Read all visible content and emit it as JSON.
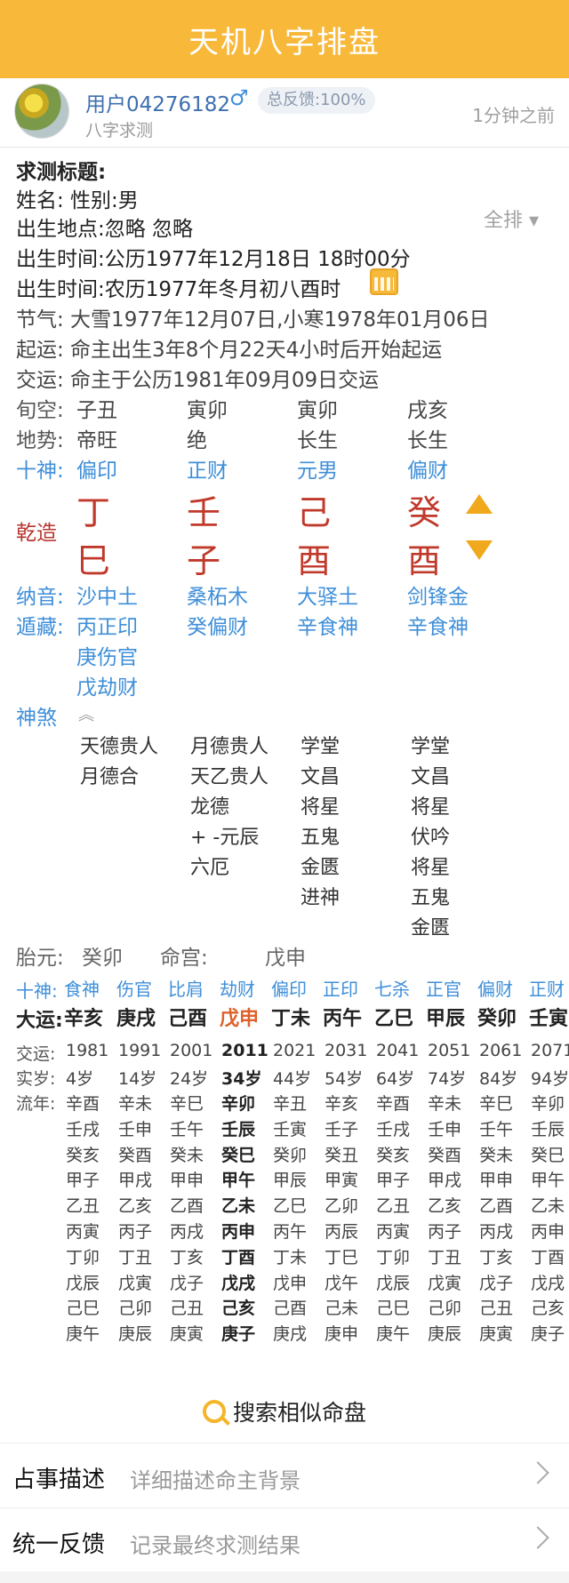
{
  "header": {
    "title": "天机八字排盘"
  },
  "user": {
    "name": "用户04276182",
    "gender_symbol": "♂",
    "feedback": "总反馈:100%",
    "subtitle": "八字求测",
    "time": "1分钟之前"
  },
  "info": {
    "title_label": "求测标题:",
    "name_line": "姓名:  性别:男",
    "place_line": "出生地点:忽略  忽略",
    "solar_line": "出生时间:公历1977年12月18日 18时00分",
    "lunar_line": "出生时间:农历1977年冬月初八酉时",
    "jieqi_line": "节气: 大雪1977年12月07日,小寒1978年01月06日",
    "qiyun_line": "起运: 命主出生3年8个月22天4小时后开始起运",
    "jiaoyun_line": "交运: 命主于公历1981年09月09日交运",
    "full_button": "全排 ▾"
  },
  "pillars": {
    "labels": {
      "xunkong": "旬空:",
      "dishi": "地势:",
      "shishen": "十神:",
      "qianzao": "乾造",
      "nayin": "纳音:",
      "dunchang": "遁藏:",
      "shensha": "神煞"
    },
    "xunkong": [
      "子丑",
      "寅卯",
      "寅卯",
      "戌亥"
    ],
    "dishi": [
      "帝旺",
      "绝",
      "长生",
      "长生"
    ],
    "shishen": [
      "偏印",
      "正财",
      "元男",
      "偏财"
    ],
    "stems": [
      "丁",
      "壬",
      "己",
      "癸"
    ],
    "branches": [
      "巳",
      "子",
      "酉",
      "酉"
    ],
    "nayin": [
      "沙中土",
      "桑柘木",
      "大驿土",
      "剑锋金"
    ],
    "canggan": [
      [
        "丙正印",
        "庚伤官",
        "戊劫财"
      ],
      [
        "癸偏财"
      ],
      [
        "辛食神"
      ],
      [
        "辛食神"
      ]
    ],
    "shensha": [
      [
        "天德贵人",
        "月德合"
      ],
      [
        "月德贵人",
        "天乙贵人",
        "龙德",
        "+ -元辰",
        "六厄"
      ],
      [
        "学堂",
        "文昌",
        "将星",
        "五鬼",
        "金匮",
        "进神"
      ],
      [
        "学堂",
        "文昌",
        "将星",
        "伏吟",
        "将星",
        "五鬼",
        "金匮"
      ]
    ]
  },
  "taiyuan": {
    "label1": "胎元:",
    "value1": "癸卯",
    "label2": "命宫:",
    "value2": "戊申"
  },
  "dayun": {
    "shishen_label": "十神:",
    "dayun_label": "大运:",
    "jiaoyun_label": "交运:",
    "shisui_label": "实岁:",
    "liunian_label": "流年:",
    "shishen": [
      "食神",
      "伤官",
      "比肩",
      "劫财",
      "偏印",
      "正印",
      "七杀",
      "正官",
      "偏财",
      "正财"
    ],
    "dayun": [
      "辛亥",
      "庚戌",
      "己酉",
      "戊申",
      "丁未",
      "丙午",
      "乙巳",
      "甲辰",
      "癸卯",
      "壬寅"
    ],
    "years": [
      "1981",
      "1991",
      "2001",
      "2011",
      "2021",
      "2031",
      "2041",
      "2051",
      "2061",
      "2071"
    ],
    "ages": [
      "4岁",
      "14岁",
      "24岁",
      "34岁",
      "44岁",
      "54岁",
      "64岁",
      "74岁",
      "84岁",
      "94岁"
    ],
    "selected_index": 3,
    "liunian": [
      [
        "辛酉",
        "壬戌",
        "癸亥",
        "甲子",
        "乙丑",
        "丙寅",
        "丁卯",
        "戊辰",
        "己巳",
        "庚午"
      ],
      [
        "辛未",
        "壬申",
        "癸酉",
        "甲戌",
        "乙亥",
        "丙子",
        "丁丑",
        "戊寅",
        "己卯",
        "庚辰"
      ],
      [
        "辛巳",
        "壬午",
        "癸未",
        "甲申",
        "乙酉",
        "丙戌",
        "丁亥",
        "戊子",
        "己丑",
        "庚寅"
      ],
      [
        "辛卯",
        "壬辰",
        "癸巳",
        "甲午",
        "乙未",
        "丙申",
        "丁酉",
        "戊戌",
        "己亥",
        "庚子"
      ],
      [
        "辛丑",
        "壬寅",
        "癸卯",
        "甲辰",
        "乙巳",
        "丙午",
        "丁未",
        "戊申",
        "己酉",
        "庚戌"
      ],
      [
        "辛亥",
        "壬子",
        "癸丑",
        "甲寅",
        "乙卯",
        "丙辰",
        "丁巳",
        "戊午",
        "己未",
        "庚申"
      ],
      [
        "辛酉",
        "壬戌",
        "癸亥",
        "甲子",
        "乙丑",
        "丙寅",
        "丁卯",
        "戊辰",
        "己巳",
        "庚午"
      ],
      [
        "辛未",
        "壬申",
        "癸酉",
        "甲戌",
        "乙亥",
        "丙子",
        "丁丑",
        "戊寅",
        "己卯",
        "庚辰"
      ],
      [
        "辛巳",
        "壬午",
        "癸未",
        "甲申",
        "乙酉",
        "丙戌",
        "丁亥",
        "戊子",
        "己丑",
        "庚寅"
      ],
      [
        "辛卯",
        "壬辰",
        "癸巳",
        "甲午",
        "乙未",
        "丙申",
        "丁酉",
        "戊戌",
        "己亥",
        "庚子"
      ]
    ]
  },
  "search": {
    "label": "搜索相似命盘",
    "icon": "search-icon"
  },
  "entries": [
    {
      "title": "占事描述",
      "placeholder": "详细描述命主背景"
    },
    {
      "title": "统一反馈",
      "placeholder": "记录最终求测结果"
    }
  ]
}
